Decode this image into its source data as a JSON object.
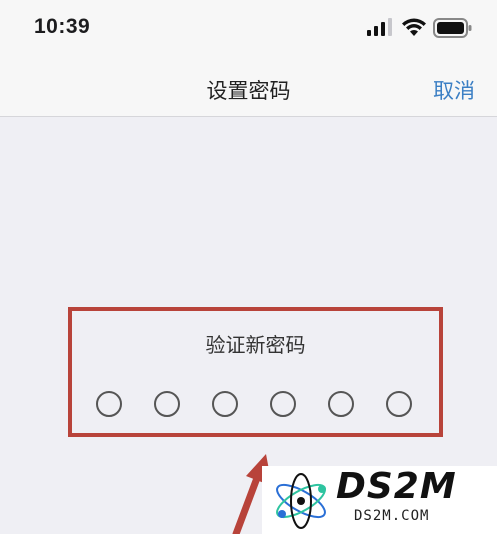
{
  "status_bar": {
    "time": "10:39",
    "icons": [
      "signal-icon",
      "wifi-icon",
      "battery-icon"
    ]
  },
  "nav": {
    "title": "设置密码",
    "cancel_label": "取消"
  },
  "verify": {
    "label": "验证新密码",
    "digits_total": 6,
    "digits_entered": 0
  },
  "annotation": {
    "box_color": "#b8433a",
    "arrow_color": "#b8433a"
  },
  "watermark": {
    "brand": "DS2M",
    "url": "DS2M.COM"
  },
  "colors": {
    "accent": "#3b7fc4",
    "background": "#efeff4"
  }
}
